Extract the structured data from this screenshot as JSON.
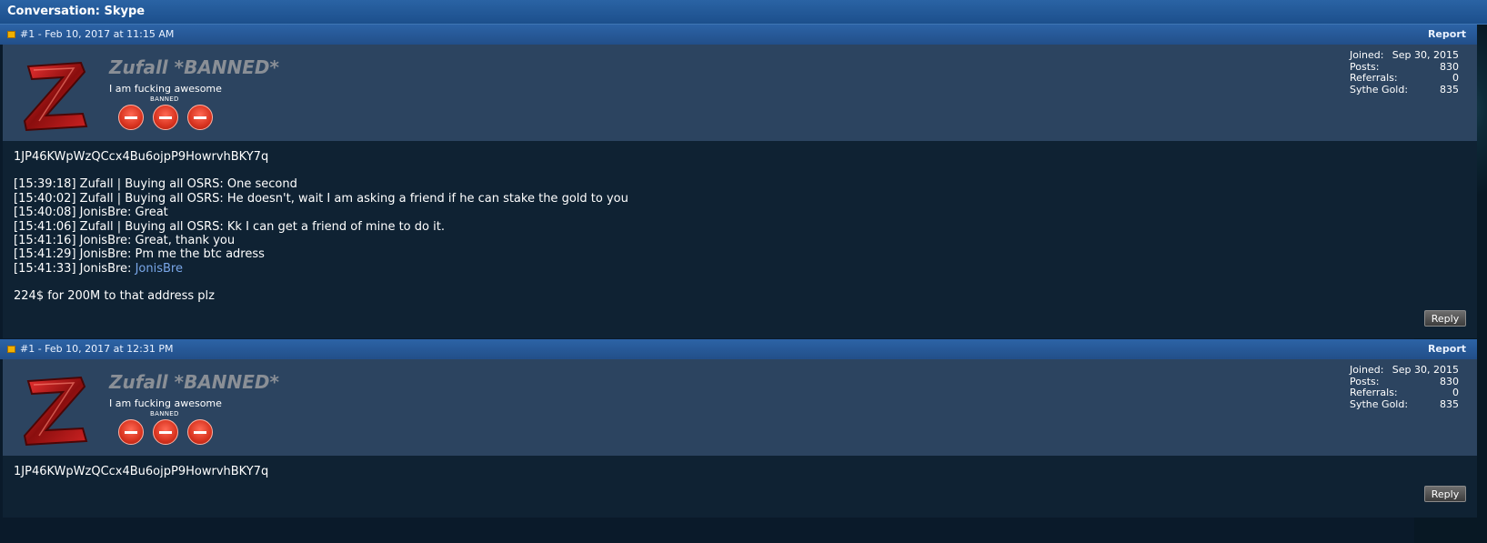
{
  "conversation": {
    "title": "Conversation: Skype"
  },
  "posts": [
    {
      "header": {
        "label": "#1 - Feb 10, 2017 at 11:15 AM",
        "report": "Report"
      },
      "user": {
        "name": "Zufall *BANNED*",
        "title": "I am fucking awesome",
        "badge_label": "BANNED",
        "stats": [
          {
            "k": "Joined:",
            "v": "Sep 30, 2015"
          },
          {
            "k": "Posts:",
            "v": "830"
          },
          {
            "k": "Referrals:",
            "v": "0"
          },
          {
            "k": "Sythe Gold:",
            "v": "835"
          }
        ]
      },
      "lines": [
        "1JP46KWpWzQCcx4Bu6ojpP9HowrvhBKY7q",
        "[15:39:18] Zufall | Buying all OSRS: One second",
        "[15:40:02] Zufall | Buying all OSRS: He doesn't, wait I am asking a friend if he can stake the gold to you",
        "[15:40:08] JonisBre: Great",
        "[15:41:06] Zufall | Buying all OSRS: Kk I can get a friend of mine to do it.",
        "[15:41:16] JonisBre: Great, thank you",
        "[15:41:29] JonisBre: Pm me the btc adress",
        "[15:41:33] JonisBre: ",
        "224$ for 200M to that address plz"
      ],
      "mention": "JonisBre",
      "reply": "Reply"
    },
    {
      "header": {
        "label": "#1 - Feb 10, 2017 at 12:31 PM",
        "report": "Report"
      },
      "user": {
        "name": "Zufall *BANNED*",
        "title": "I am fucking awesome",
        "badge_label": "BANNED",
        "stats": [
          {
            "k": "Joined:",
            "v": "Sep 30, 2015"
          },
          {
            "k": "Posts:",
            "v": "830"
          },
          {
            "k": "Referrals:",
            "v": "0"
          },
          {
            "k": "Sythe Gold:",
            "v": "835"
          }
        ]
      },
      "lines": [
        "1JP46KWpWzQCcx4Bu6ojpP9HowrvhBKY7q"
      ],
      "reply": "Reply"
    }
  ],
  "icons": {
    "post_icon": "post-icon",
    "avatar": "z-logo-avatar",
    "badge": "no-entry-icon"
  },
  "colors": {
    "header": "#2c63a6",
    "userbar": "#2c4460",
    "body": "#0f2233",
    "banned_badge": "#d8331f",
    "link": "#79a6e8"
  }
}
